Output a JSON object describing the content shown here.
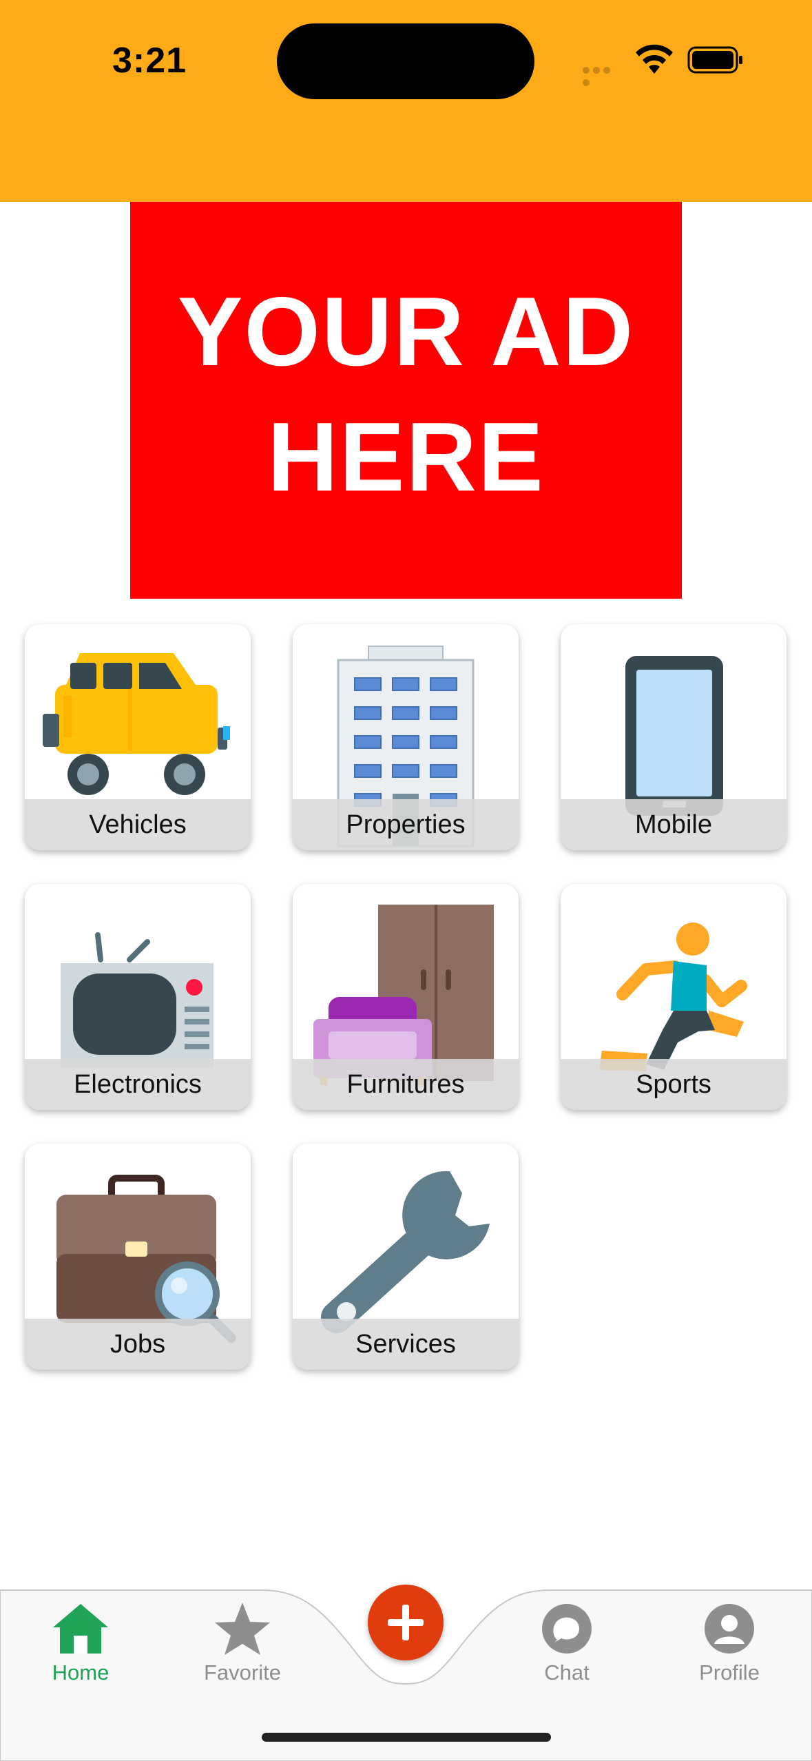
{
  "status_bar": {
    "time": "3:21"
  },
  "ad": {
    "line1": "YOUR AD",
    "line2": "HERE"
  },
  "categories": [
    {
      "label": "Vehicles",
      "icon": "car-icon"
    },
    {
      "label": "Properties",
      "icon": "building-icon"
    },
    {
      "label": "Mobile",
      "icon": "smartphone-icon"
    },
    {
      "label": "Electronics",
      "icon": "tv-icon"
    },
    {
      "label": "Furnitures",
      "icon": "furniture-icon"
    },
    {
      "label": "Sports",
      "icon": "running-person-icon"
    },
    {
      "label": "Jobs",
      "icon": "briefcase-search-icon"
    },
    {
      "label": "Services",
      "icon": "wrench-icon"
    }
  ],
  "bottom_nav": {
    "items": [
      {
        "label": "Home",
        "icon": "home-icon",
        "active": true
      },
      {
        "label": "Favorite",
        "icon": "star-icon",
        "active": false
      },
      {
        "label": "Chat",
        "icon": "chat-bubble-icon",
        "active": false
      },
      {
        "label": "Profile",
        "icon": "user-icon",
        "active": false
      }
    ],
    "add_icon": "plus-icon"
  },
  "colors": {
    "header": "#FEAB17",
    "ad_background": "#FF0000",
    "active_nav": "#1FA356",
    "inactive_nav": "#8E8E8E",
    "fab": "#E03C0E"
  }
}
